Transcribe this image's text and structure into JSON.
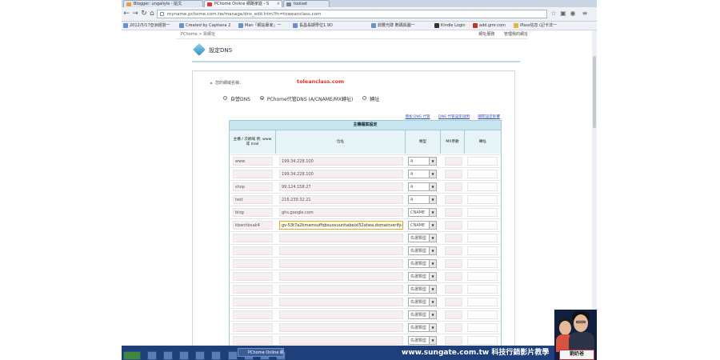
{
  "browser": {
    "tabs": [
      {
        "label": "Blogger: ungaliyle - 貼文"
      },
      {
        "label": "PChome Online 網路家庭 - S"
      },
      {
        "label": "toolset"
      }
    ],
    "url": "myname.pchome.com.tw/manage/dns_edit.htm?fn=toweanclass.com",
    "bookmarks": [
      {
        "label": "2012/5/17亞洲經營一"
      },
      {
        "label": "Created by Captiana 2"
      },
      {
        "label": "Man「網站專家」一"
      },
      {
        "label": "長昌長期學位1.9D"
      },
      {
        "label": "鼎豐光碟 數碼與圖一"
      },
      {
        "label": "Kindle Login"
      },
      {
        "label": "add.gmr.com"
      },
      {
        "label": "iPass信息 (記卡法一"
      }
    ]
  },
  "page": {
    "breadcrumb": "PChome > 買網址",
    "top_links": [
      "網址服務",
      "管理我的網址"
    ],
    "section_title": "設定DNS",
    "domain_label": "您的網域名稱：",
    "domain_value": "toleanclass.com",
    "radio_options": [
      {
        "label": "自營DNS",
        "checked": false
      },
      {
        "label": "PChome代管DNS (A/CNAME/MX轉址)",
        "checked": true
      },
      {
        "label": "轉址",
        "checked": false
      }
    ],
    "help_links": [
      "增加 DNS 代管",
      "DNS 代管設定說明",
      "關閉設定影響"
    ],
    "table": {
      "caption": "主機檔案設定",
      "headers": [
        "主機 / 次網域 例: www 或 mail",
        "位址",
        "類型",
        "MX參數",
        "轉址"
      ],
      "rows": [
        {
          "host": "www",
          "address": "199.34.228.100",
          "type": "A"
        },
        {
          "host": "",
          "address": "199.34.228.100",
          "type": "A"
        },
        {
          "host": "shop",
          "address": "99.124.158.27",
          "type": "A"
        },
        {
          "host": "test",
          "address": "216.239.32.21",
          "type": "A"
        },
        {
          "host": "blog",
          "address": "ghs.google.com",
          "type": "CNAME"
        },
        {
          "host": "kbenhbxak4",
          "address": "gv-53t7a2kmamsuffqbsuovuunhabeixl52ahea.domainverify.googleapis.com",
          "type": "CNAME",
          "highlight": true
        },
        {
          "host": "",
          "address": "",
          "type": "先選類型"
        },
        {
          "host": "",
          "address": "",
          "type": "先選類型"
        },
        {
          "host": "",
          "address": "",
          "type": "先選類型"
        },
        {
          "host": "",
          "address": "",
          "type": "先選類型"
        },
        {
          "host": "",
          "address": "",
          "type": "先選類型"
        },
        {
          "host": "",
          "address": "",
          "type": "先選類型"
        },
        {
          "host": "",
          "address": "",
          "type": "先選類型"
        },
        {
          "host": "",
          "address": "",
          "type": "先選類型"
        },
        {
          "host": "",
          "address": "",
          "type": "先選類型"
        }
      ]
    }
  },
  "overlay": {
    "taskbar_window": "PChome Online 網路",
    "watermark": "www.sungate.com.tw 科技行銷影片教學",
    "logo_name": "劉奶爸"
  }
}
